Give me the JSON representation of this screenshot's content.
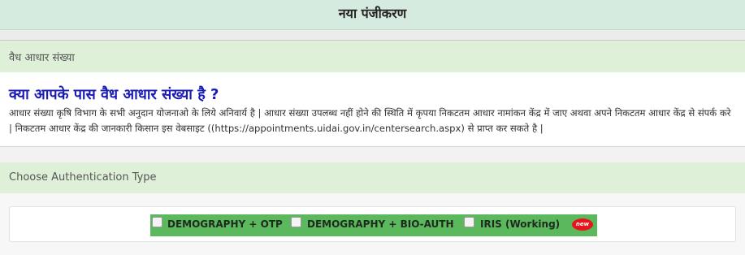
{
  "header": {
    "title": "नया पंजीकरण"
  },
  "aadhaar_section": {
    "heading": "वैध आधार संख्या",
    "question": "क्या आपके पास वैध आधार संख्या है ?",
    "description": "आधार संख्या कृषि विभाग के सभी अनुदान योजनाओ के लिये अनिवार्य है | आधार संख्या उपलब्ध नहीं होने की स्थिति में कृपया निकटतम आधार नामांकन केंद्र में जाए अथवा अपने निकटतम आधार केंद्र से संपर्क करे | निकटतम आधार केंद्र की जानकारी किसान इस वेबसाइट ((https://appointments.uidai.gov.in/centersearch.aspx) से प्राप्त कर सकते है |"
  },
  "auth_section": {
    "heading": "Choose Authentication Type",
    "options": [
      {
        "label": "DEMOGRAPHY + OTP",
        "checked": false
      },
      {
        "label": "DEMOGRAPHY + BIO-AUTH",
        "checked": false
      },
      {
        "label": "IRIS (Working)",
        "checked": false
      }
    ],
    "new_badge": "new"
  },
  "colors": {
    "title_bg": "#d6ebe0",
    "section_bg": "#dff0d8",
    "question_text": "#1a1ab5",
    "auth_strip": "#5cb85c",
    "badge": "#e8141c"
  }
}
